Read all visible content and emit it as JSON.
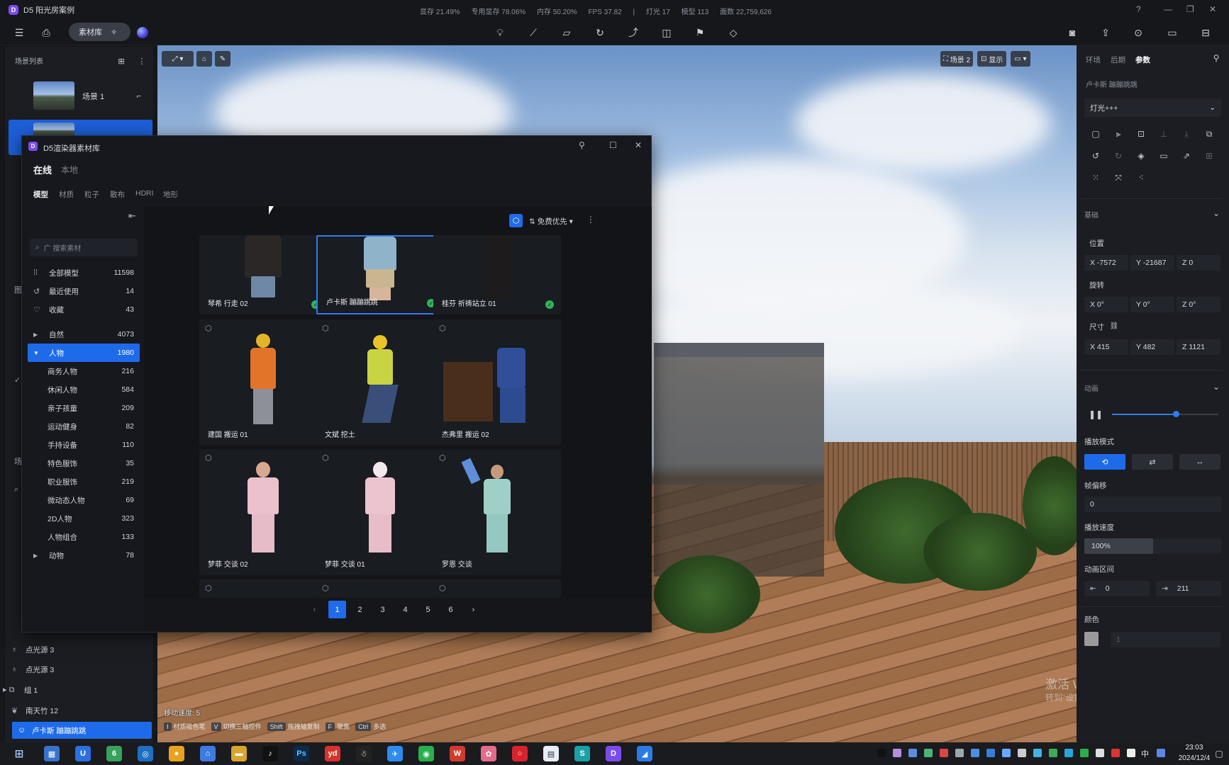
{
  "app": {
    "title": "D5 阳光房案例",
    "logo": "D"
  },
  "stats": [
    "显存 21.49%",
    "专用显存 78.06%",
    "内存 50.20%",
    "FPS 37.82",
    "|",
    "灯光 17",
    "模型 113",
    "面数 22,759,626"
  ],
  "toolbar": {
    "library_label": "素材库"
  },
  "scene_list": {
    "title": "场景列表",
    "scene1": "场景 1"
  },
  "viewport": {
    "scene_badge": "场景 2",
    "display_label": "显示",
    "move_speed": "移动速度: 5",
    "shortcuts": [
      {
        "key": "I",
        "label": "材质吸色笔"
      },
      {
        "key": "V",
        "label": "切换三轴控件"
      },
      {
        "key": "Shift",
        "label": "拖拽轴复制"
      },
      {
        "key": "F",
        "label": "聚焦"
      },
      {
        "key": "Ctrl",
        "label": "多选"
      }
    ]
  },
  "library": {
    "title": "D5渲染器素材库",
    "tab_online": "在线",
    "tab_local": "本地",
    "subtabs": [
      "模型",
      "材质",
      "粒子",
      "散布",
      "HDRI",
      "地形"
    ],
    "search_placeholder": "广 搜索素材",
    "sort_label": "免费优先",
    "categories": [
      {
        "label": "全部模型",
        "count": "11598",
        "icon": "grid-icon"
      },
      {
        "label": "最近使用",
        "count": "14",
        "icon": "history-icon"
      },
      {
        "label": "收藏",
        "count": "43",
        "icon": "heart-icon"
      },
      {
        "label": "自然",
        "count": "4073",
        "icon": "caret-right-icon"
      },
      {
        "label": "人物",
        "count": "1980",
        "icon": "caret-down-icon"
      },
      {
        "label": "商务人物",
        "count": "216"
      },
      {
        "label": "休闲人物",
        "count": "584"
      },
      {
        "label": "亲子孩童",
        "count": "209"
      },
      {
        "label": "运动健身",
        "count": "82"
      },
      {
        "label": "手持设备",
        "count": "110"
      },
      {
        "label": "特色服饰",
        "count": "35"
      },
      {
        "label": "职业服饰",
        "count": "219"
      },
      {
        "label": "微动态人物",
        "count": "69"
      },
      {
        "label": "2D人物",
        "count": "323"
      },
      {
        "label": "人物组合",
        "count": "133"
      },
      {
        "label": "动物",
        "count": "78",
        "icon": "caret-right-icon"
      }
    ],
    "cards": [
      {
        "name": "琴希 行走 02",
        "downloaded": true
      },
      {
        "name": "卢卡斯 蹦蹦跳跳",
        "downloaded": true,
        "selected": true
      },
      {
        "name": "桂芬 祈祷站立 01",
        "downloaded": true
      },
      {
        "name": "建国 搬运 01",
        "downloaded": false
      },
      {
        "name": "文斌 挖土",
        "downloaded": false
      },
      {
        "name": "杰弗里 搬运 02",
        "downloaded": false
      },
      {
        "name": "梦菲 交谈 02",
        "downloaded": false
      },
      {
        "name": "梦菲 交谈 01",
        "downloaded": false
      },
      {
        "name": "罗恩 交谈",
        "downloaded": false
      }
    ],
    "pages": [
      "1",
      "2",
      "3",
      "4",
      "5",
      "6"
    ],
    "current_page": "1"
  },
  "left_lower": {
    "items": [
      "点光源 3",
      "点光源 3",
      "组 1",
      "南天竹 12",
      "卢卡斯 蹦蹦跳跳"
    ],
    "strip_labels": [
      "图",
      "场"
    ]
  },
  "right_panel": {
    "tabs": [
      "环境",
      "后期",
      "参数"
    ],
    "object_name": "卢卡斯 蹦蹦跳跳",
    "preset": "灯光+++",
    "section_basic": "基础",
    "position_label": "位置",
    "position": {
      "x": "X -7572",
      "y": "Y -21687",
      "z": "Z 0"
    },
    "rotation_label": "旋转",
    "rotation": {
      "x": "X 0°",
      "y": "Y 0°",
      "z": "Z 0°"
    },
    "size_label": "尺寸",
    "size": {
      "x": "X 415",
      "y": "Y 482",
      "z": "Z 1121"
    },
    "section_anim": "动画",
    "anim_progress": 0.6,
    "play_mode_label": "播放模式",
    "frame_offset_label": "帧偏移",
    "frame_offset": "0",
    "speed_label": "播放速度",
    "speed": "100%",
    "range_label": "动画区间",
    "range_start": "0",
    "range_end": "211",
    "color_label": "颜色",
    "color_value": "1"
  },
  "watermark": {
    "line1": "激活 Windows",
    "line2": "转到\"设置\"以激活 Windows。"
  },
  "taskbar": {
    "time": "23:03",
    "date": "2024/12/4",
    "ime": "中"
  },
  "colors": {
    "accent": "#1e6bea",
    "panel": "#1b1d22",
    "check": "#2fb457"
  }
}
